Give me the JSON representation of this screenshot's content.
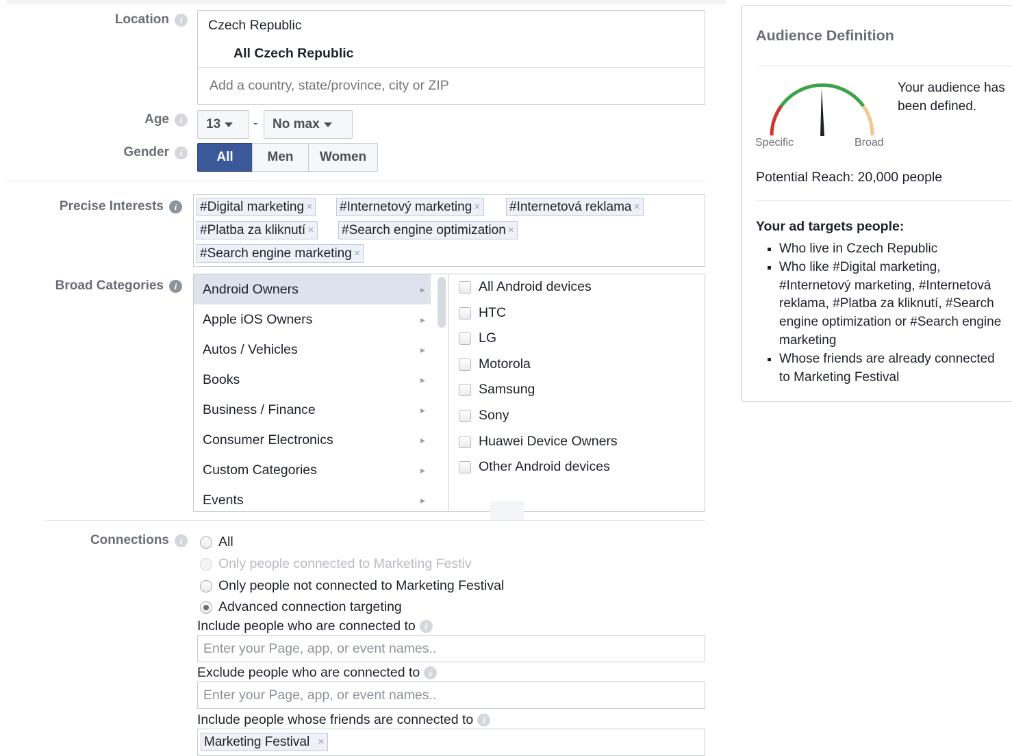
{
  "location": {
    "label": "Location",
    "country": "Czech Republic",
    "region": "All Czech Republic",
    "placeholder": "Add a country, state/province, city or ZIP"
  },
  "age": {
    "label": "Age",
    "min": "13",
    "separator": "-",
    "max": "No max"
  },
  "gender": {
    "label": "Gender",
    "options": [
      "All",
      "Men",
      "Women"
    ],
    "selected": "All"
  },
  "interests": {
    "label": "Precise Interests",
    "tags": [
      "#Digital marketing",
      "#Internetový marketing",
      "#Internetová reklama",
      "#Platba za kliknutí",
      "#Search engine optimization",
      "#Search engine marketing"
    ],
    "remove_glyph": "×"
  },
  "broad": {
    "label": "Broad Categories",
    "categories": [
      "Android Owners",
      "Apple iOS Owners",
      "Autos / Vehicles",
      "Books",
      "Business / Finance",
      "Consumer Electronics",
      "Custom Categories",
      "Events"
    ],
    "arrow_glyph": "▸",
    "options": [
      "All Android devices",
      "HTC",
      "LG",
      "Motorola",
      "Samsung",
      "Sony",
      "Huawei Device Owners",
      "Other Android devices"
    ]
  },
  "connections": {
    "label": "Connections",
    "options": [
      "All",
      "Only people connected to Marketing Festiv",
      "Only people not connected to Marketing Festival",
      "Advanced connection targeting"
    ],
    "selected_index": 3,
    "include_label": "Include people who are connected to",
    "exclude_label": "Exclude people who are connected to",
    "friends_label": "Include people whose friends are connected to",
    "field_placeholder": "Enter your Page, app, or event names..",
    "friends_tag": "Marketing Festival"
  },
  "audience": {
    "title": "Audience Definition",
    "status": "Your audience has been defined.",
    "specific": "Specific",
    "broad": "Broad",
    "reach": "Potential Reach: 20,000 people",
    "targets_heading": "Your ad targets people:",
    "targets": [
      "Who live in Czech Republic",
      "Who like #Digital marketing, #Internetový marketing, #Internetová reklama, #Platba za kliknutí, #Search engine optimization or #Search engine marketing",
      "Whose friends are already connected to Marketing Festival"
    ],
    "colors": {
      "specific": "#d0352b",
      "mid": "#3aa346",
      "broad": "#f3c690",
      "needle": "#1d2129"
    }
  },
  "colors": {
    "accent": "#3b5998",
    "selected_row": "#dde2ec"
  }
}
